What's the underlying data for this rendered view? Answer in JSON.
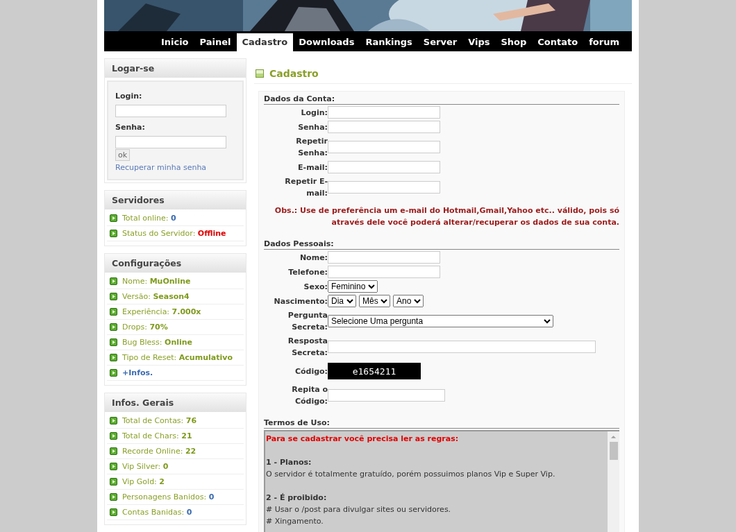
{
  "nav": [
    {
      "label": "Inicio",
      "selected": false
    },
    {
      "label": "Painel",
      "selected": false
    },
    {
      "label": "Cadastro",
      "selected": true
    },
    {
      "label": "Downloads",
      "selected": false
    },
    {
      "label": "Rankings",
      "selected": false
    },
    {
      "label": "Server",
      "selected": false
    },
    {
      "label": "Vips",
      "selected": false
    },
    {
      "label": "Shop",
      "selected": false
    },
    {
      "label": "Contato",
      "selected": false
    },
    {
      "label": "forum",
      "selected": false
    }
  ],
  "login_box": {
    "title": "Logar-se",
    "login_label": "Login:",
    "password_label": "Senha:",
    "button": "ok",
    "recover_link": "Recuperar minha senha"
  },
  "sidebar_sections": [
    {
      "title": "Servidores",
      "items": [
        {
          "kind": "info",
          "label": "Total online:",
          "value": "0",
          "color": "#3a6ab0"
        },
        {
          "kind": "info",
          "label": "Status do Servidor:",
          "value": "Offline",
          "color": "#e00000"
        }
      ]
    },
    {
      "title": "Configurações",
      "items": [
        {
          "kind": "info",
          "label": "Nome:",
          "value": "MuOnline",
          "color": "#7e9a1c"
        },
        {
          "kind": "info",
          "label": "Versão:",
          "value": "Season4",
          "color": "#7e9a1c"
        },
        {
          "kind": "info",
          "label": "Experiência:",
          "value": "7.000x",
          "color": "#7e9a1c"
        },
        {
          "kind": "info",
          "label": "Drops:",
          "value": "70%",
          "color": "#7e9a1c"
        },
        {
          "kind": "info",
          "label": "Bug Bless:",
          "value": "Online",
          "color": "#7e9a1c"
        },
        {
          "kind": "info",
          "label": "Tipo de Reset:",
          "value": "Acumulativo",
          "color": "#7e9a1c"
        },
        {
          "kind": "link",
          "label": "+Infos."
        }
      ]
    },
    {
      "title": "Infos. Gerais",
      "items": [
        {
          "kind": "info",
          "label": "Total de Contas:",
          "value": "76",
          "color": "#7e9a1c"
        },
        {
          "kind": "info",
          "label": "Total de Chars:",
          "value": "21",
          "color": "#7e9a1c"
        },
        {
          "kind": "info",
          "label": "Recorde Online:",
          "value": "22",
          "color": "#7e9a1c"
        },
        {
          "kind": "info",
          "label": "Vip Silver:",
          "value": "0",
          "color": "#7e9a1c"
        },
        {
          "kind": "info",
          "label": "Vip Gold:",
          "value": "2",
          "color": "#7e9a1c"
        },
        {
          "kind": "info",
          "label": "Personagens Banidos:",
          "value": "0",
          "color": "#3a6ab0"
        },
        {
          "kind": "info",
          "label": "Contas Banidas:",
          "value": "0",
          "color": "#3a6ab0"
        }
      ]
    }
  ],
  "page_title": "Cadastro",
  "form_sections": [
    {
      "title": "Dados da Conta:",
      "fields": [
        {
          "kind": "input",
          "label": "Login:"
        },
        {
          "kind": "input",
          "label": "Senha:"
        },
        {
          "kind": "input",
          "label": "Repetir Senha:"
        },
        {
          "kind": "input",
          "label": "E-mail:"
        },
        {
          "kind": "input",
          "label": "Repetir E-mail:"
        }
      ],
      "note": "Obs.: Use de preferência um e-mail do Hotmail,Gmail,Yahoo etc.. válido, pois só através dele você poderá alterar/recuperar os dados de sua conta."
    },
    {
      "title": "Dados Pessoais:",
      "fields": [
        {
          "kind": "input",
          "label": "Nome:"
        },
        {
          "kind": "input",
          "label": "Telefone:"
        },
        {
          "kind": "select",
          "label": "Sexo:",
          "options": [
            "Feminino"
          ]
        },
        {
          "kind": "select",
          "label": "Nascimento:",
          "options": [
            "Dia",
            "Mês",
            "Ano"
          ]
        },
        {
          "kind": "wide-select",
          "label": "Pergunta Secreta:",
          "options": [
            "Selecione Uma pergunta"
          ]
        },
        {
          "kind": "wide-input",
          "label": "Resposta Secreta:"
        },
        {
          "kind": "captcha",
          "label": "Código:",
          "code": "e1654211"
        },
        {
          "kind": "code-input",
          "label": "Repita o Código:"
        }
      ]
    }
  ],
  "terms": {
    "title": "Termos de Uso:",
    "lines": [
      {
        "kind": "warning",
        "text": "Para se cadastrar você precisa ler as regras:"
      },
      {
        "kind": "heading",
        "text": "1 - Planos:"
      },
      {
        "kind": "text",
        "text": "O servidor é totalmente gratuído, porém possuimos planos Vip e Super Vip."
      },
      {
        "kind": "heading",
        "text": "2 - É proibido:"
      },
      {
        "kind": "text",
        "text": "# Usar o /post para divulgar sites ou servidores."
      },
      {
        "kind": "text",
        "text": "# Xingamento."
      }
    ]
  }
}
